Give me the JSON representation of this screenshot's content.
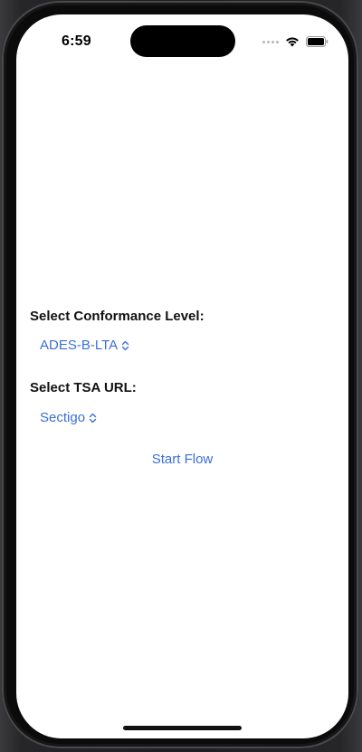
{
  "status_bar": {
    "time": "6:59"
  },
  "form": {
    "conformance_label": "Select Conformance Level:",
    "conformance_value": "ADES-B-LTA",
    "tsa_label": "Select TSA URL:",
    "tsa_value": "Sectigo",
    "start_label": "Start Flow"
  },
  "icons": {
    "picker": "chevron-up-down-icon",
    "wifi": "wifi-icon",
    "battery": "battery-icon"
  },
  "colors": {
    "accent": "#3b6fd8",
    "label": "#111111",
    "background": "#ffffff"
  }
}
